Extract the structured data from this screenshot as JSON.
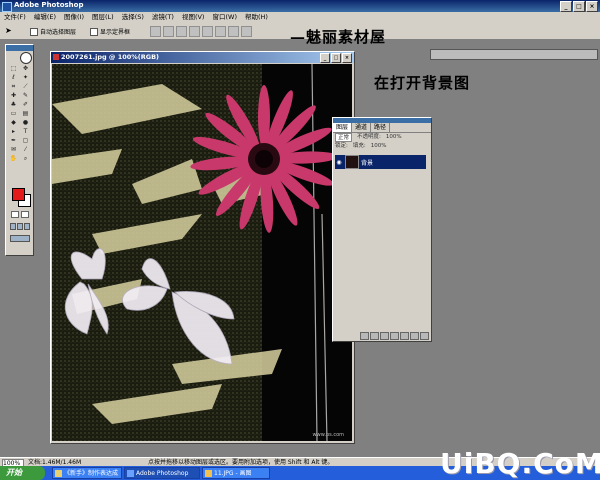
{
  "app": {
    "title": "Adobe Photoshop"
  },
  "window_controls": [
    "_",
    "□",
    "×"
  ],
  "menu": [
    "文件(F)",
    "编辑(E)",
    "图像(I)",
    "图层(L)",
    "选择(S)",
    "滤镜(T)",
    "视图(V)",
    "窗口(W)",
    "帮助(H)"
  ],
  "options_bar": {
    "auto_select": "自动选择图层",
    "show_bounds": "显示定界框"
  },
  "overlay": {
    "watermark": "—魅丽素材屋",
    "caption": "在打开背景图"
  },
  "document": {
    "title": "2007261.jpg @ 100%(RGB)"
  },
  "toolbox": {
    "fg_color": "#e31b1b",
    "bg_color": "#ffffff"
  },
  "layers_panel": {
    "tabs": [
      "图层",
      "通道",
      "路径"
    ],
    "blend_mode": "正常",
    "opacity_label": "不透明度:",
    "opacity": "100%",
    "lock_label": "锁定:",
    "fill_label": "填充:",
    "fill": "100%",
    "layer_name": "背景"
  },
  "status": {
    "zoom": "100%",
    "doc_size": "文档:1.46M/1.46M",
    "hint": "点按并拖移以移动图层或选区。要用附加选项，使用 Shift 和 Alt 键。"
  },
  "taskbar": {
    "start": "开始",
    "items": [
      "《新手》制作表达成",
      "Adobe Photoshop",
      "11.JPG - 画图"
    ]
  },
  "brand": "UiBQ.CoM"
}
